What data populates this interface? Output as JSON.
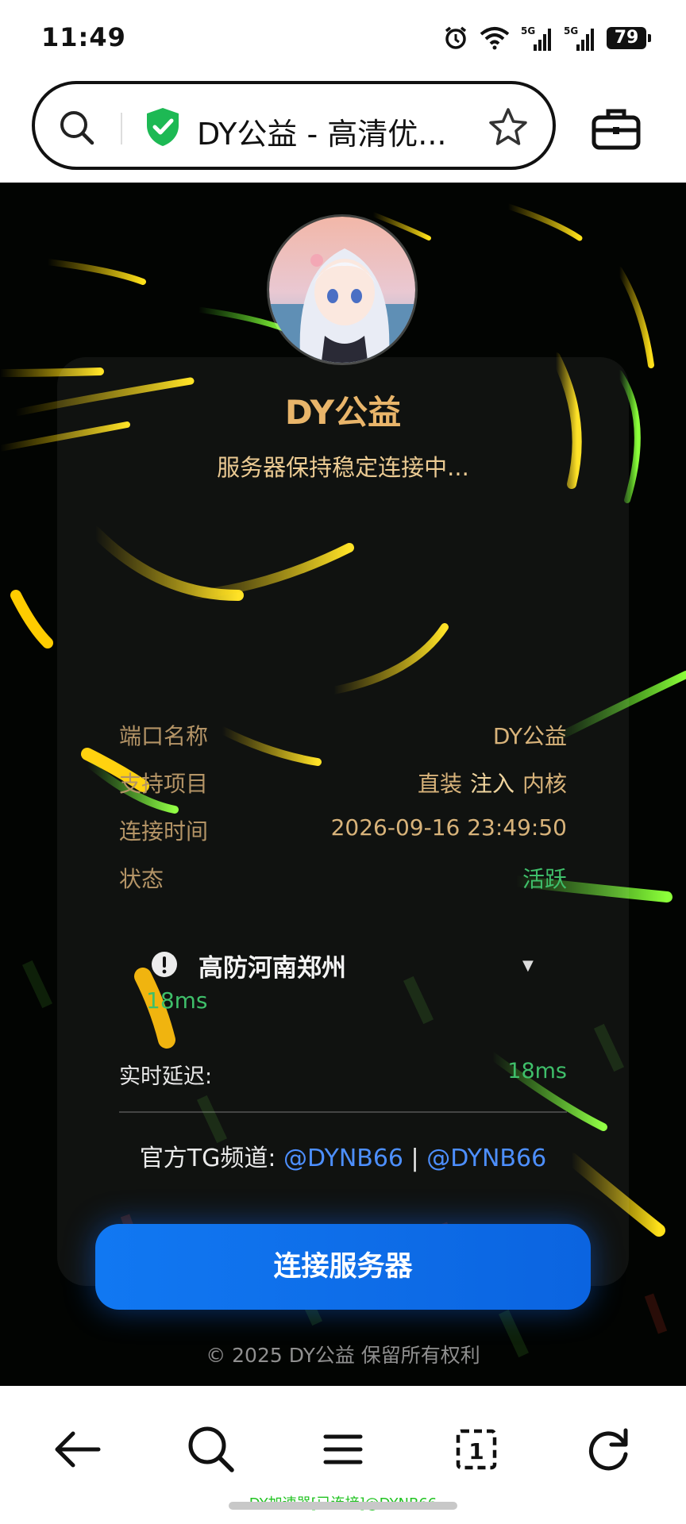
{
  "status_bar": {
    "time": "11:49",
    "battery": "79",
    "icons": [
      "alarm-icon",
      "wifi-icon",
      "signal-5g-icon",
      "signal-5g-icon",
      "battery-icon"
    ],
    "signal_labels": [
      "5G",
      "5G"
    ]
  },
  "address_bar": {
    "page_title": "DY公益 - 高清优...",
    "icons": [
      "search-icon",
      "shield-check-icon",
      "star-icon",
      "toolbox-icon"
    ]
  },
  "card": {
    "title": "DY公益",
    "subtitle": "服务器保持稳定连接中...",
    "info": {
      "port_name_label": "端口名称",
      "port_name_value": "DY公益",
      "support_label": "支持项目",
      "support_tags": [
        "直装",
        "注入",
        "内核"
      ],
      "connect_time_label": "连接时间",
      "connect_time_value": "2026-09-16 23:49:50",
      "status_label": "状态",
      "status_value": "活跃"
    },
    "server": {
      "name": "高防河南郑州",
      "ping": "18ms"
    },
    "latency": {
      "label": "实时延迟:",
      "value": "18ms"
    },
    "tg": {
      "prefix": "官方TG频道: ",
      "link1": "@DYNB66",
      "separator": " | ",
      "link2": "@DYNB66"
    },
    "connect_button_label": "连接服务器",
    "footer": "© 2025 DY公益 保留所有权利"
  },
  "bottom_nav": {
    "tab_count": "1",
    "icons": [
      "back-arrow-icon",
      "search-icon",
      "menu-icon",
      "tabs-icon",
      "refresh-icon"
    ]
  },
  "overlay_text": "DY加速器[已连接]@DYNB66",
  "colors": {
    "gold": "#e9b56a",
    "green": "#3fbf6a",
    "link_blue": "#4d8fff",
    "button_blue": "#1178f2"
  }
}
